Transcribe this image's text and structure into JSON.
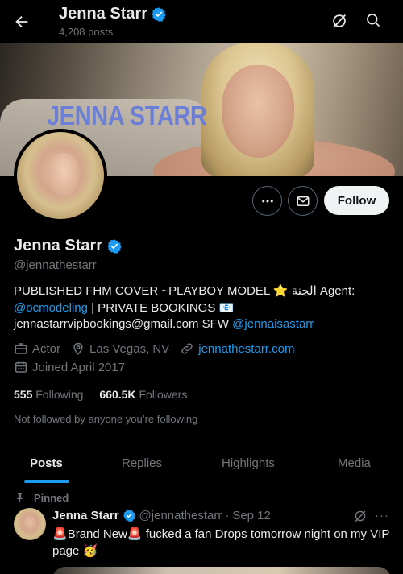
{
  "header": {
    "title": "Jenna Starr",
    "posts_count": "4,208 posts"
  },
  "banner": {
    "text": "JENNA STARR"
  },
  "actions": {
    "follow_label": "Follow"
  },
  "profile": {
    "name": "Jenna Starr",
    "handle": "@jennathestarr",
    "bio": {
      "line1_text": "PUBLISHED FHM COVER ~PLAYBOY MODEL ",
      "line1_emoji": "⭐",
      "line1_tail": " الجنة Agent:",
      "line2_link": "@ocmodeling",
      "line2_text": " | PRIVATE BOOKINGS ",
      "line2_emoji": "📧",
      "line3_text": "jennastarrvipbookings@gmail.com SFW ",
      "line3_link": "@jennaisastarr"
    },
    "category": "Actor",
    "location": "Las Vegas, NV",
    "website": "jennathestarr.com",
    "joined": "Joined April 2017",
    "following_count": "555",
    "following_label": "Following",
    "followers_count": "660.5K",
    "followers_label": "Followers",
    "not_followed": "Not followed by anyone you’re following"
  },
  "tabs": [
    {
      "label": "Posts"
    },
    {
      "label": "Replies"
    },
    {
      "label": "Highlights"
    },
    {
      "label": "Media"
    }
  ],
  "pinned_post": {
    "pinned_label": "Pinned",
    "author_name": "Jenna Starr",
    "author_handle": "@jennathestarr",
    "separator": "·",
    "date": "Sep 12",
    "more": "···",
    "emoji_siren": "🚨",
    "text_a": "Brand New",
    "text_b": " fucked a fan Drops tomorrow night on my VIP page ",
    "emoji_party": "🥳"
  },
  "colors": {
    "accent": "#1d9bf0",
    "background": "#000000",
    "muted": "#71767b",
    "text": "#e7e9ea",
    "follow_bg": "#eff3f4"
  },
  "icons": {
    "back": "arrow-left-icon",
    "grok": "grok-icon",
    "search": "search-icon",
    "more": "more-icon",
    "message": "mail-icon",
    "verified": "verified-badge-icon",
    "briefcase": "briefcase-icon",
    "location": "location-pin-icon",
    "link": "link-icon",
    "calendar": "calendar-icon",
    "pin": "pin-icon"
  }
}
